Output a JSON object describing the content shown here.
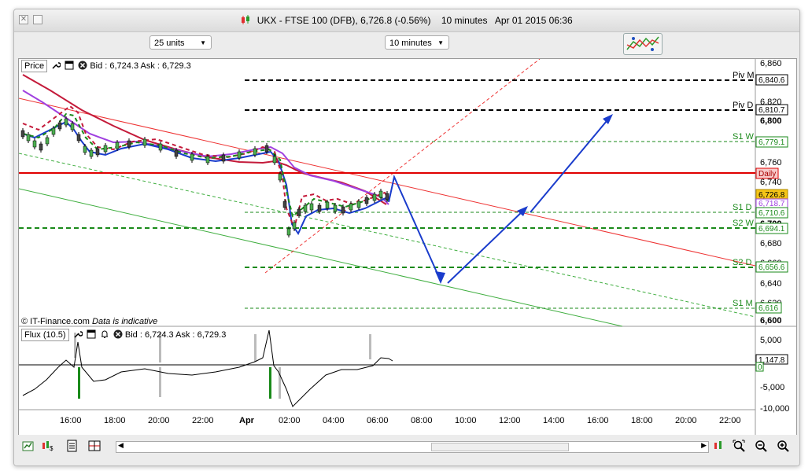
{
  "window": {
    "title": "UKX - FTSE 100 (DFB)",
    "price": "6,726.8",
    "change": "(-0.56%)",
    "interval": "10 minutes",
    "datetime": "Apr 01 2015 06:36"
  },
  "toolbar": {
    "units_value": "25 units",
    "interval_value": "10 minutes"
  },
  "price_panel": {
    "label": "Price",
    "quote": "Bid : 6,724.3 Ask : 6,729.3",
    "watermark": "© IT-Finance.com",
    "watermark_note": "Data is indicative",
    "y_ticks": [
      "6,860",
      "6,820",
      "6,800",
      "6,760",
      "6,740",
      "6,700",
      "6,680",
      "6,660",
      "6,640",
      "6,620",
      "6,600"
    ],
    "levels": [
      {
        "name": "Piv M",
        "value": "6,840.6"
      },
      {
        "name": "Piv D",
        "value": "6,810.7"
      },
      {
        "name": "S1 W",
        "value": "6,779.1"
      },
      {
        "name": "Daily",
        "value": ""
      },
      {
        "name": "S1 D",
        "value": "6,710.6"
      },
      {
        "name": "S2 W",
        "value": "6,694.1"
      },
      {
        "name": "S2 D",
        "value": "6,656.6"
      },
      {
        "name": "S1 M",
        "value": "6,616"
      }
    ],
    "current_price": "6,726.8",
    "ma_value": "6,718.7"
  },
  "flux_panel": {
    "label": "Flux (10.5)",
    "quote": "Bid : 6,724.3 Ask : 6,729.3",
    "y_ticks": [
      "5,000",
      "0",
      "-5,000",
      "-10,000"
    ],
    "value_box": "1,147.8",
    "zero_box": "0"
  },
  "x_axis": {
    "ticks": [
      "16:00",
      "18:00",
      "20:00",
      "22:00",
      "Apr",
      "02:00",
      "04:00",
      "06:00",
      "08:00",
      "10:00",
      "12:00",
      "14:00",
      "16:00",
      "18:00",
      "20:00",
      "22:00"
    ]
  },
  "colors": {
    "accent_red": "#e00000",
    "green_dash": "#1a8a1a",
    "blue_arrow": "#1a3ccc",
    "purple": "#a040e0"
  }
}
